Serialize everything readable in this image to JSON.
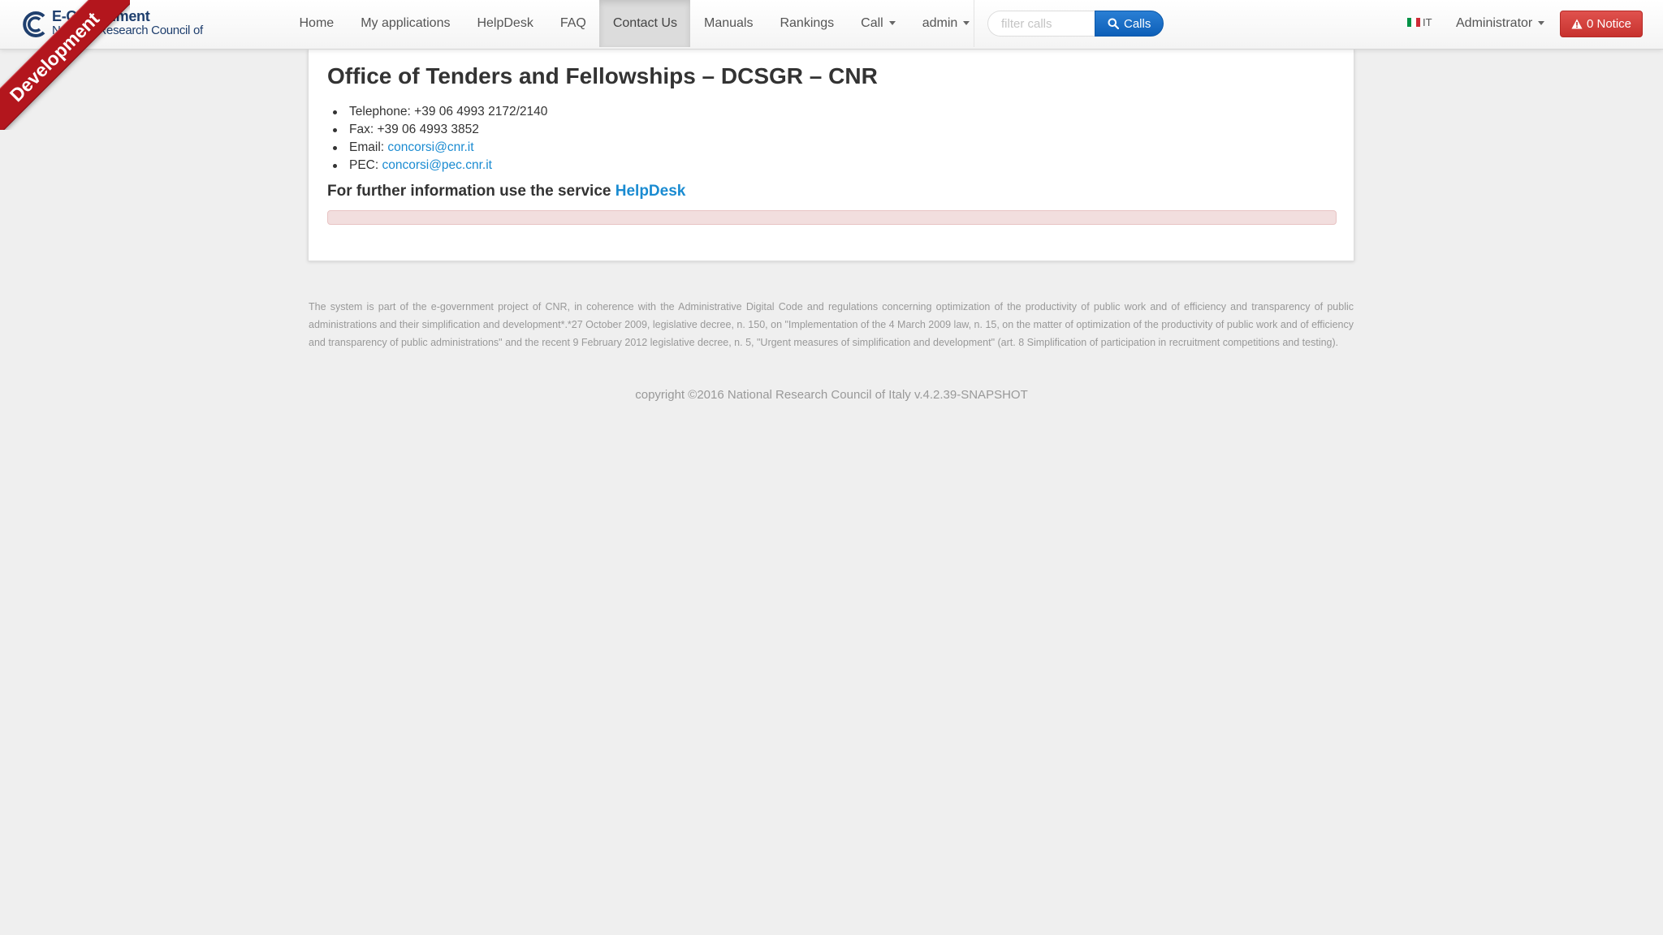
{
  "brand": {
    "line1": "E-Government",
    "line2": "National Research Council of Italy"
  },
  "ribbon": {
    "label": "Development"
  },
  "nav": {
    "items": [
      {
        "label": "Home"
      },
      {
        "label": "My applications"
      },
      {
        "label": "HelpDesk"
      },
      {
        "label": "FAQ"
      },
      {
        "label": "Contact Us",
        "active": true
      },
      {
        "label": "Manuals"
      },
      {
        "label": "Rankings"
      },
      {
        "label": "Call",
        "dropdown": true
      },
      {
        "label": "admin",
        "dropdown": true
      }
    ]
  },
  "search": {
    "placeholder": "filter calls",
    "button_label": "Calls",
    "button_icon": "search-icon"
  },
  "language": {
    "code": "IT",
    "flag_colors": [
      "#009246",
      "#ffffff",
      "#ce2b37"
    ]
  },
  "user": {
    "label": "Administrator"
  },
  "notice": {
    "label": "0 Notice",
    "icon": "warning-icon"
  },
  "main": {
    "title": "Office of Tenders and Fellowships – DCSGR – CNR",
    "contacts": [
      {
        "label": "Telephone: ",
        "value": "+39 06 4993 2172/2140"
      },
      {
        "label": "Fax: ",
        "value": "+39 06 4993 3852"
      },
      {
        "label": "Email: ",
        "link": "concorsi@cnr.it"
      },
      {
        "label": "PEC: ",
        "link": "concorsi@pec.cnr.it"
      }
    ],
    "further_text": "For further information use the service ",
    "further_link": "HelpDesk"
  },
  "footer": {
    "text": "The system is part of the e-government project of CNR, in coherence with the Administrative Digital Code and regulations concerning optimization of the productivity of public work and of efficiency and transparency of public administrations and their simplification and development*.*27 October 2009, legislative decree, n. 150, on \"Implementation of the 4 March 2009 law, n. 15, on the matter of optimization of the productivity of public work and of efficiency and transparency of public administrations\" and the recent 9 February 2012 legislative decree, n. 5, \"Urgent measures of simplification and development\" (art. 8  Simplification of participation in recruitment competitions and testing).",
    "copyright": "copyright ©2016 National Research Council of Italy v.4.2.39-SNAPSHOT"
  },
  "colors": {
    "link": "#1a8bd1",
    "primary_button": "#0d5fb8",
    "danger_button": "#c7322e",
    "ribbon": "#b3161d",
    "alert_background": "#f2dede"
  }
}
